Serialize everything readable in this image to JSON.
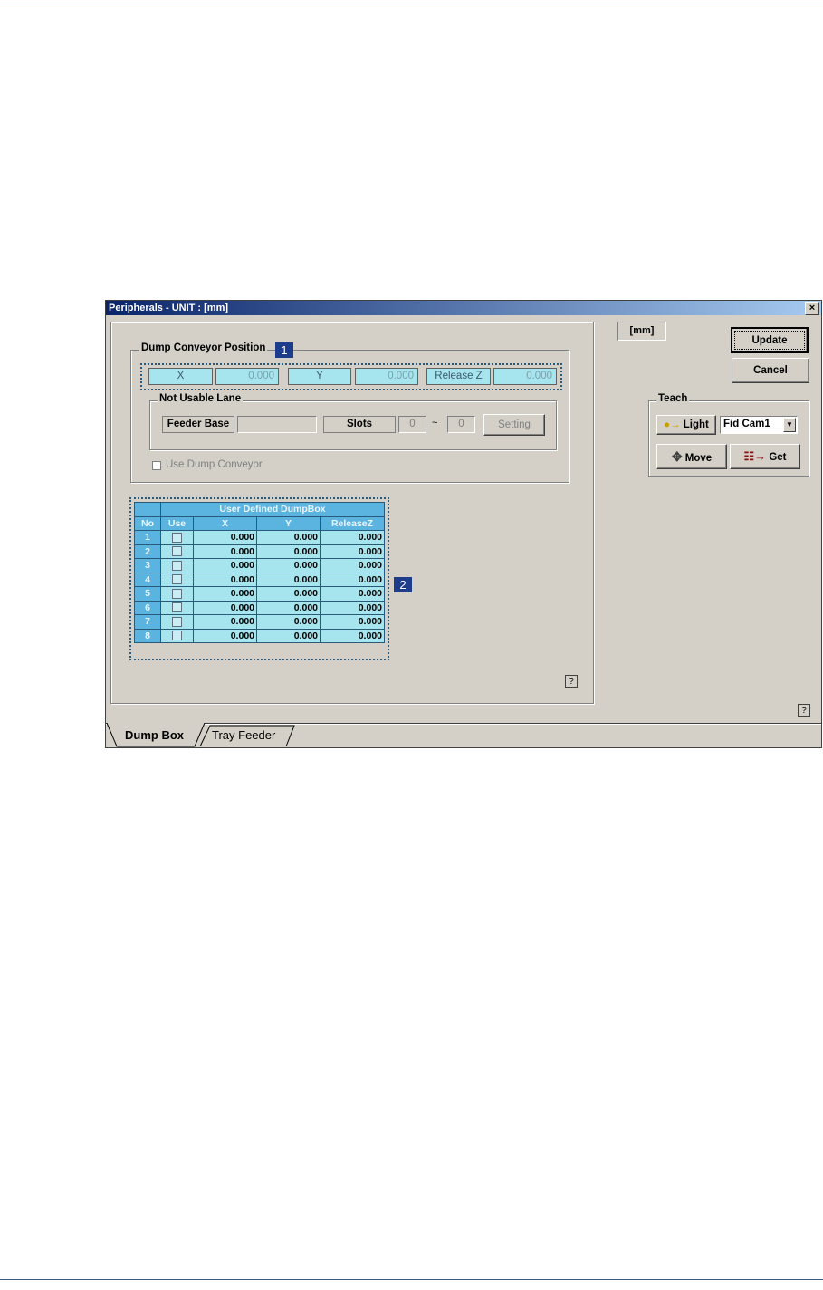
{
  "window": {
    "title": "Peripherals - UNIT : [mm]",
    "close_glyph": "×"
  },
  "dump_conveyor": {
    "legend": "Dump Conveyor Position",
    "marker": "1",
    "x_label": "X",
    "x_value": "0.000",
    "y_label": "Y",
    "y_value": "0.000",
    "z_label": "Release Z",
    "z_value": "0.000",
    "not_usable_lane": {
      "legend": "Not Usable Lane",
      "feeder_base_label": "Feeder Base",
      "feeder_base_value": "",
      "slots_label": "Slots",
      "slot_from": "0",
      "slot_separator": "~",
      "slot_to": "0",
      "setting_button": "Setting"
    },
    "use_checkbox_label": "Use Dump Conveyor"
  },
  "dumpbox_table": {
    "marker": "2",
    "title": "User Defined DumpBox",
    "columns": [
      "No",
      "Use",
      "X",
      "Y",
      "ReleaseZ"
    ],
    "rows": [
      {
        "no": "1",
        "x": "0.000",
        "y": "0.000",
        "z": "0.000"
      },
      {
        "no": "2",
        "x": "0.000",
        "y": "0.000",
        "z": "0.000"
      },
      {
        "no": "3",
        "x": "0.000",
        "y": "0.000",
        "z": "0.000"
      },
      {
        "no": "4",
        "x": "0.000",
        "y": "0.000",
        "z": "0.000"
      },
      {
        "no": "5",
        "x": "0.000",
        "y": "0.000",
        "z": "0.000"
      },
      {
        "no": "6",
        "x": "0.000",
        "y": "0.000",
        "z": "0.000"
      },
      {
        "no": "7",
        "x": "0.000",
        "y": "0.000",
        "z": "0.000"
      },
      {
        "no": "8",
        "x": "0.000",
        "y": "0.000",
        "z": "0.000"
      }
    ]
  },
  "right_panel": {
    "unit_label": "[mm]",
    "update_button": "Update",
    "cancel_button": "Cancel",
    "teach": {
      "legend": "Teach",
      "light_button": "Light",
      "camera_select": "Fid Cam1",
      "move_button": "Move",
      "get_button": "Get"
    }
  },
  "help_glyph": "?",
  "tabs": [
    "Dump Box",
    "Tray Feeder"
  ],
  "colors": {
    "accent_cyan": "#a6e4ee",
    "table_header_blue": "#5bb4e0",
    "marker_blue": "#1e3c8c"
  }
}
